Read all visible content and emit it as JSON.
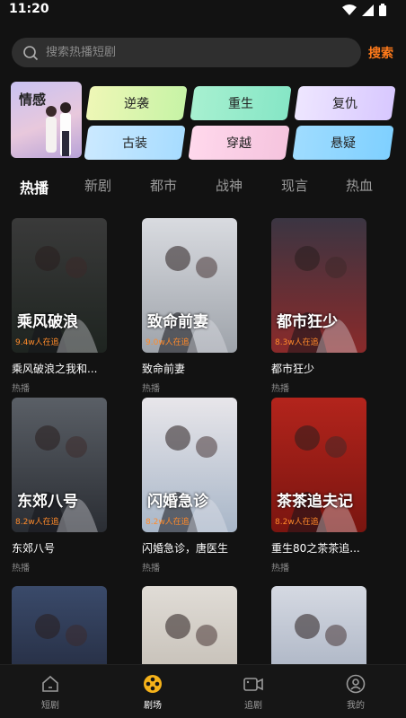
{
  "status": {
    "time": "11:20"
  },
  "search": {
    "placeholder": "搜索热播短剧",
    "button": "搜索"
  },
  "feature": {
    "label": "情感"
  },
  "categories": [
    "逆袭",
    "重生",
    "复仇",
    "古装",
    "穿越",
    "悬疑"
  ],
  "tabs": [
    "热播",
    "新剧",
    "都市",
    "战神",
    "现言",
    "热血"
  ],
  "dramas": [
    {
      "title": "乘风破浪之我和...",
      "sub": "热播",
      "views": "9.4w人在追",
      "poster_text": "乘风破浪",
      "colors": [
        "#3a3a3a",
        "#1e2420"
      ]
    },
    {
      "title": "致命前妻",
      "sub": "热播",
      "views": "9.0w人在追",
      "poster_text": "致命前妻",
      "colors": [
        "#d9dbe0",
        "#9ea3aa"
      ]
    },
    {
      "title": "都市狂少",
      "sub": "热播",
      "views": "8.3w人在追",
      "poster_text": "都市狂少",
      "colors": [
        "#3b3542",
        "#8a2a2a"
      ]
    },
    {
      "title": "东郊八号",
      "sub": "热播",
      "views": "8.2w人在追",
      "poster_text": "东郊八号",
      "colors": [
        "#5a5f66",
        "#2a2d33"
      ]
    },
    {
      "title": "闪婚急诊，唐医生",
      "sub": "热播",
      "views": "8.2w人在追",
      "poster_text": "闪婚急诊",
      "colors": [
        "#e8e6ea",
        "#a8b6c8"
      ]
    },
    {
      "title": "重生80之茶茶追...",
      "sub": "热播",
      "views": "8.2w人在追",
      "poster_text": "茶茶追夫记",
      "colors": [
        "#b3241c",
        "#7a1510"
      ]
    },
    {
      "title": "",
      "sub": "",
      "views": "",
      "poster_text": "",
      "colors": [
        "#3a4a6a",
        "#1c2030"
      ]
    },
    {
      "title": "",
      "sub": "",
      "views": "",
      "poster_text": "",
      "colors": [
        "#e0dcd6",
        "#b9b2a8"
      ]
    },
    {
      "title": "",
      "sub": "",
      "views": "",
      "poster_text": "",
      "colors": [
        "#d5d9e2",
        "#98a3b6"
      ]
    }
  ],
  "nav": [
    {
      "label": "短剧",
      "icon": "home-icon"
    },
    {
      "label": "剧场",
      "icon": "film-reel-icon"
    },
    {
      "label": "追剧",
      "icon": "video-camera-icon"
    },
    {
      "label": "我的",
      "icon": "user-icon"
    }
  ],
  "colors": {
    "accent": "#ff7a1a",
    "background": "#121212",
    "views": "#ff8a2a"
  }
}
